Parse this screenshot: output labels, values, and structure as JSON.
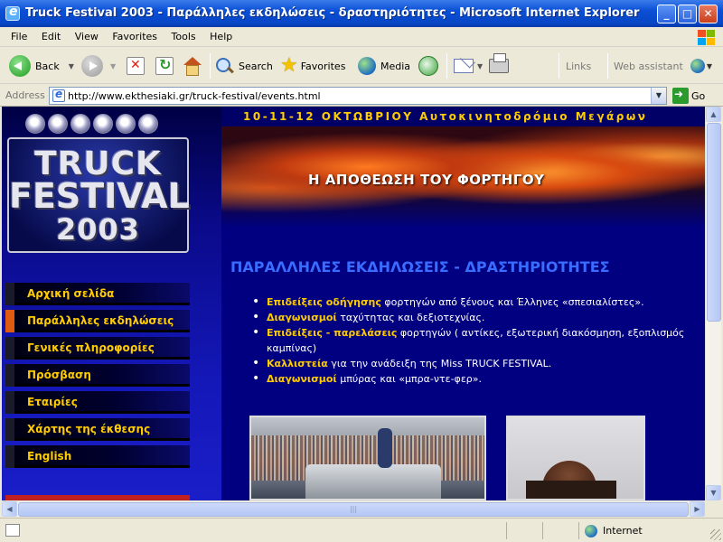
{
  "window": {
    "title": "Truck Festival 2003 - Παράλληλες εκδηλώσεις - δραστηριότητες - Microsoft Internet Explorer",
    "min_glyph": "_",
    "max_glyph": "□",
    "close_glyph": "✕"
  },
  "menu": {
    "file": "File",
    "edit": "Edit",
    "view": "View",
    "favorites": "Favorites",
    "tools": "Tools",
    "help": "Help"
  },
  "toolbar": {
    "back": "Back",
    "search": "Search",
    "favorites": "Favorites",
    "media": "Media",
    "links": "Links",
    "web_assistant": "Web assistant"
  },
  "address": {
    "label": "Address",
    "url": "http://www.ekthesiaki.gr/truck-festival/events.html",
    "go": "Go"
  },
  "page": {
    "logo": {
      "line1": "TRUCK",
      "line2": "FESTIVAL",
      "line3": "2003"
    },
    "nav": [
      {
        "label": "Αρχική σελίδα",
        "active": false
      },
      {
        "label": "Παράλληλες εκδηλώσεις",
        "active": true
      },
      {
        "label": "Γενικές πληροφορίες",
        "active": false
      },
      {
        "label": "Πρόσβαση",
        "active": false
      },
      {
        "label": "Εταιρίες",
        "active": false
      },
      {
        "label": "Χάρτης της έκθεσης",
        "active": false
      },
      {
        "label": "English",
        "active": false
      }
    ],
    "date_banner": "10-11-12 ΟΚΤΩΒΡΙΟΥ Αυτοκινητοδρόμιο Μεγάρων",
    "slogan": "Η ΑΠΟΘΕΩΣΗ ΤΟΥ ΦΟΡΤΗΓΟΥ",
    "section_title": "ΠΑΡΑΛΛΗΛΕΣ ΕΚΔΗΛΩΣΕΙΣ - ΔΡΑΣΤΗΡΙΟΤΗΤΕΣ",
    "bullets": [
      {
        "bold": "Επιδείξεις οδήγησης",
        "rest": " φορτηγών από ξένους και Έλληνες «σπεσιαλίστες»."
      },
      {
        "bold": "Διαγωνισμοί",
        "rest": " ταχύτητας και δεξιοτεχνίας."
      },
      {
        "bold": "Επιδείξεις - παρελάσεις",
        "rest": " φορτηγών ( αντίκες, εξωτερική διακόσμηση, εξοπλισμός καμπίνας)"
      },
      {
        "bold": "Καλλιστεία",
        "rest": " για την ανάδειξη της Miss TRUCK FESTIVAL."
      },
      {
        "bold": "Διαγωνισμοί",
        "rest": " μπύρας και «μπρα-ντε-φερ»."
      }
    ]
  },
  "status": {
    "zone": "Internet"
  },
  "colors": {
    "nav_text": "#ffcc00",
    "section_title": "#3a6cff",
    "active_marker": "#e05a10",
    "page_bg": "#000080"
  }
}
